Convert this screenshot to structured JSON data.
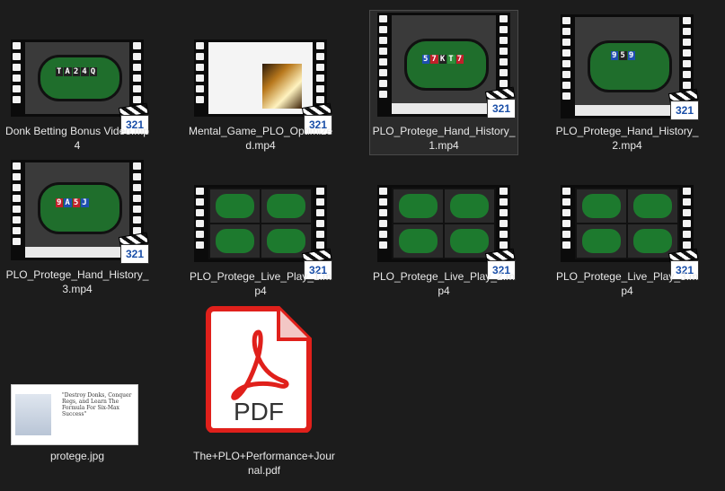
{
  "files": [
    {
      "name": "Donk Betting Bonus Video.mp4",
      "type": "video",
      "thumb": "table",
      "cards": [
        "T",
        "A",
        "2",
        "4",
        "Q"
      ],
      "badge": "321",
      "selected": false
    },
    {
      "name": "Mental_Game_PLO_Optimized.mp4",
      "type": "video",
      "thumb": "document",
      "badge": "321",
      "selected": false
    },
    {
      "name": "PLO_Protege_Hand_History_1.mp4",
      "type": "video",
      "thumb": "table",
      "cards": [
        "5",
        "7",
        "K",
        "T",
        "7"
      ],
      "badge": "321",
      "selected": true
    },
    {
      "name": "PLO_Protege_Hand_History_2.mp4",
      "type": "video",
      "thumb": "table",
      "cards": [
        "9",
        "5",
        "9"
      ],
      "badge": "321",
      "selected": false
    },
    {
      "name": "PLO_Protege_Hand_History_3.mp4",
      "type": "video",
      "thumb": "table",
      "cards": [
        "9",
        "A",
        "5",
        "J"
      ],
      "badge": "321",
      "selected": false
    },
    {
      "name": "PLO_Protege_Live_Play_1.mp4",
      "type": "video",
      "thumb": "grid",
      "badge": "321",
      "selected": false
    },
    {
      "name": "PLO_Protege_Live_Play_2.mp4",
      "type": "video",
      "thumb": "grid",
      "badge": "321",
      "selected": false
    },
    {
      "name": "PLO_Protege_Live_Play_3.mp4",
      "type": "video",
      "thumb": "grid",
      "badge": "321",
      "selected": false
    },
    {
      "name": "protege.jpg",
      "type": "image",
      "thumb": "image",
      "selected": false
    },
    {
      "name": "The+PLO+Performance+Journal.pdf",
      "type": "pdf",
      "thumb": "pdf",
      "pdf_label": "PDF",
      "selected": false
    }
  ],
  "colors": {
    "background": "#1c1c1c",
    "pdf_red": "#e0201b",
    "badge_blue": "#1a4fa8"
  }
}
